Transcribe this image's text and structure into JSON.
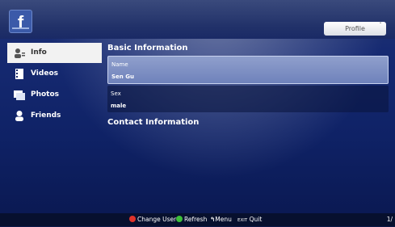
{
  "header": {
    "logo": "f",
    "profile_label": "Profile",
    "profile_caret": "ˇ"
  },
  "sidebar": {
    "items": [
      {
        "label": "Info",
        "icon": "info-icon",
        "active": true
      },
      {
        "label": "Videos",
        "icon": "film-icon",
        "active": false
      },
      {
        "label": "Photos",
        "icon": "photo-icon",
        "active": false
      },
      {
        "label": "Friends",
        "icon": "person-icon",
        "active": false
      }
    ]
  },
  "main": {
    "basic_title": "Basic Information",
    "fields": [
      {
        "label": "Name",
        "value": "Sen Gu",
        "selected": true
      },
      {
        "label": "Sex",
        "value": "male",
        "selected": false
      }
    ],
    "contact_title": "Contact Information"
  },
  "footer": {
    "change_user": "Change User",
    "refresh": "Refresh",
    "menu": "Menu",
    "exit_icon": "EXIT",
    "quit": "Quit",
    "page": "1/"
  },
  "colors": {
    "red_key": "#e0322a",
    "green_key": "#3cbf3a",
    "facebook_blue": "#3b5aa9"
  }
}
